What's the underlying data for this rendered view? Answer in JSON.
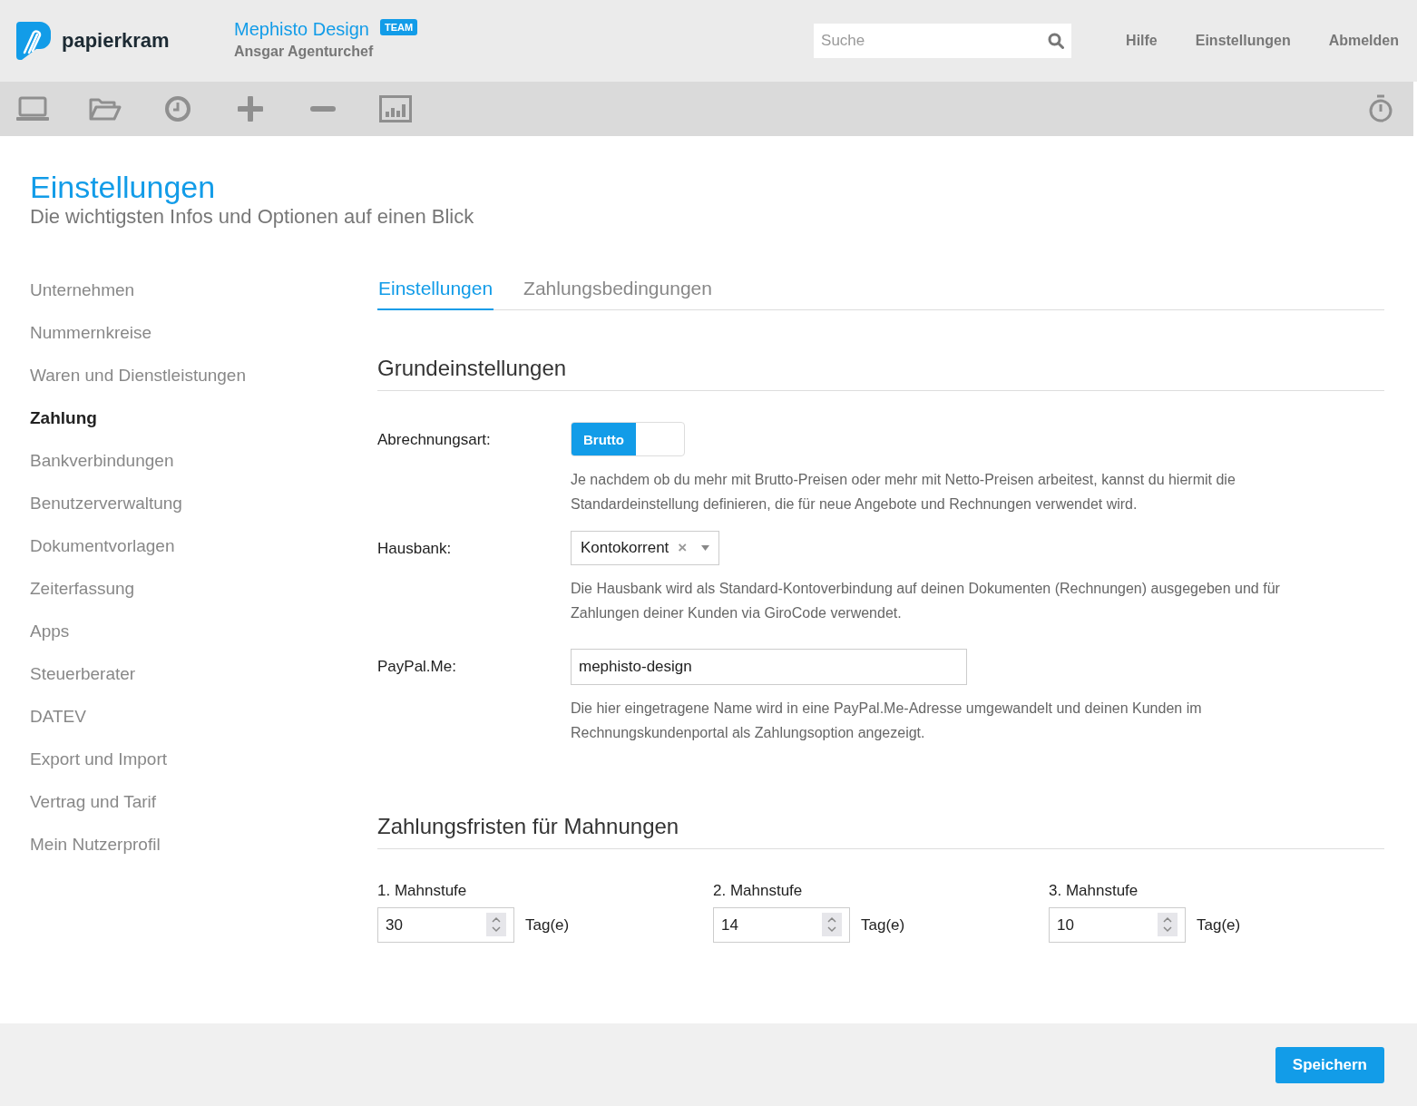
{
  "header": {
    "brand": "papierkram",
    "company": "Mephisto Design",
    "badge": "TEAM",
    "user": "Ansgar Agenturchef",
    "search": {
      "placeholder": "Suche"
    },
    "links": [
      "Hilfe",
      "Einstellungen",
      "Abmelden"
    ]
  },
  "page": {
    "title": "Einstellungen",
    "subtitle": "Die wichtigsten Infos und Optionen auf einen Blick"
  },
  "sidebar": {
    "items": [
      {
        "label": "Unternehmen",
        "selected": false
      },
      {
        "label": "Nummernkreise",
        "selected": false
      },
      {
        "label": "Waren und Dienstleistungen",
        "selected": false
      },
      {
        "label": "Zahlung",
        "selected": true
      },
      {
        "label": "Bankverbindungen",
        "selected": false
      },
      {
        "label": "Benutzerverwaltung",
        "selected": false
      },
      {
        "label": "Dokumentvorlagen",
        "selected": false
      },
      {
        "label": "Zeiterfassung",
        "selected": false
      },
      {
        "label": "Apps",
        "selected": false
      },
      {
        "label": "Steuerberater",
        "selected": false
      },
      {
        "label": "DATEV",
        "selected": false
      },
      {
        "label": "Export und Import",
        "selected": false
      },
      {
        "label": "Vertrag und Tarif",
        "selected": false
      },
      {
        "label": "Mein Nutzerprofil",
        "selected": false
      }
    ]
  },
  "tabs": [
    {
      "label": "Einstellungen",
      "selected": true
    },
    {
      "label": "Zahlungsbedingungen",
      "selected": false
    }
  ],
  "sections": [
    {
      "heading": "Grundeinstellungen",
      "fields": [
        {
          "kind": "toggle",
          "label": "Abrechnungsart:",
          "value": "Brutto",
          "on": true,
          "help": "Je nachdem ob du mehr mit Brutto-Preisen oder mehr mit Netto-Preisen arbeitest, kannst du hiermit die Standardeinstellung definieren, die für neue Angebote und Rechnungen verwendet wird."
        },
        {
          "kind": "select",
          "label": "Hausbank:",
          "value": "Kontokorrent",
          "clear": "×",
          "help": "Die Hausbank wird als Standard-Kontoverbindung auf deinen Dokumenten (Rechnungen) ausgegeben und für Zahlungen deiner Kunden via GiroCode verwendet."
        },
        {
          "kind": "text",
          "label": "PayPal.Me:",
          "value": "mephisto-design",
          "help": "Die hier eingetragene Name wird in eine PayPal.Me-Adresse umgewandelt und deinen Kunden im Rechnungskundenportal als Zahlungsoption angezeigt."
        }
      ]
    },
    {
      "heading": "Zahlungsfristen für Mahnungen",
      "stages": [
        {
          "label": "1. Mahnstufe",
          "value": "30",
          "unit": "Tag(e)"
        },
        {
          "label": "2. Mahnstufe",
          "value": "14",
          "unit": "Tag(e)"
        },
        {
          "label": "3. Mahnstufe",
          "value": "10",
          "unit": "Tag(e)"
        }
      ]
    }
  ],
  "footer": {
    "save": "Speichern"
  }
}
